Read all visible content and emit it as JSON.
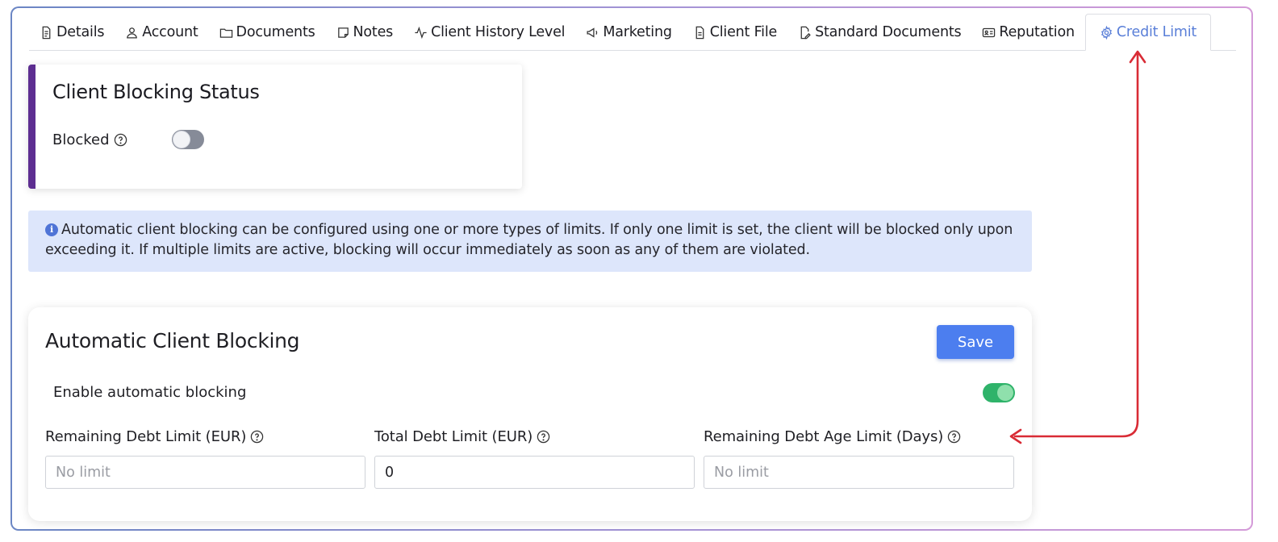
{
  "tabs": [
    {
      "label": "Details",
      "icon": "document-icon"
    },
    {
      "label": "Account",
      "icon": "user-icon"
    },
    {
      "label": "Documents",
      "icon": "folder-icon"
    },
    {
      "label": "Notes",
      "icon": "sticky-note-icon"
    },
    {
      "label": "Client History Level",
      "icon": "activity-icon"
    },
    {
      "label": "Marketing",
      "icon": "megaphone-icon"
    },
    {
      "label": "Client File",
      "icon": "file-icon"
    },
    {
      "label": "Standard Documents",
      "icon": "file-signature-icon"
    },
    {
      "label": "Reputation",
      "icon": "id-card-icon"
    },
    {
      "label": "Credit Limit",
      "icon": "gear-icon",
      "active": true
    }
  ],
  "status_card": {
    "title": "Client Blocking Status",
    "blocked_label": "Blocked",
    "blocked_enabled": false,
    "accent_color": "#5d2e91"
  },
  "info": {
    "text": "Automatic client blocking can be configured using one or more types of limits. If only one limit is set, the client will be blocked only upon exceeding it. If multiple limits are active, blocking will occur immediately as soon as any of them are violated."
  },
  "auto_card": {
    "title": "Automatic Client Blocking",
    "save_label": "Save",
    "enable_label": "Enable automatic blocking",
    "enabled": true,
    "fields": [
      {
        "label": "Remaining Debt Limit (EUR)",
        "value": "",
        "placeholder": "No limit"
      },
      {
        "label": "Total Debt Limit (EUR)",
        "value": "0",
        "placeholder": "No limit"
      },
      {
        "label": "Remaining Debt Age Limit (Days)",
        "value": "",
        "placeholder": "No limit"
      }
    ]
  },
  "colors": {
    "accent": "#4c7eef",
    "active_tab": "#5a7fd8",
    "toggle_on": "#2fb36a",
    "info_bg": "#dde6fb",
    "annotation": "#d92b35"
  }
}
